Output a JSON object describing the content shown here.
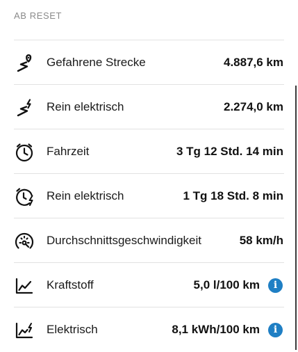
{
  "section": {
    "title": "AB RESET"
  },
  "rows": [
    {
      "icon": "route-pin-icon",
      "label": "Gefahrene Strecke",
      "value": "4.887,6 km",
      "info": false
    },
    {
      "icon": "electric-route-icon",
      "label": "Rein elektrisch",
      "value": "2.274,0 km",
      "info": false
    },
    {
      "icon": "clock-icon",
      "label": "Fahrzeit",
      "value": "3 Tg 12 Std. 14 min",
      "info": false
    },
    {
      "icon": "electric-clock-icon",
      "label": "Rein elektrisch",
      "value": "1 Tg 18 Std. 8 min",
      "info": false
    },
    {
      "icon": "speedometer-icon",
      "label": "Durchschnittsgeschwindigkeit",
      "value": "58 km/h",
      "info": false
    },
    {
      "icon": "fuel-consumption-chart-icon",
      "label": "Kraftstoff",
      "value": "5,0 l/100 km",
      "info": true,
      "info_glyph": "i"
    },
    {
      "icon": "electric-consumption-chart-icon",
      "label": "Elektrisch",
      "value": "8,1 kWh/100 km",
      "info": true,
      "info_glyph": "i"
    }
  ],
  "colors": {
    "info_accent": "#1f7fc4",
    "header_text": "#8a8a8a",
    "divider": "#e2e2e2"
  }
}
